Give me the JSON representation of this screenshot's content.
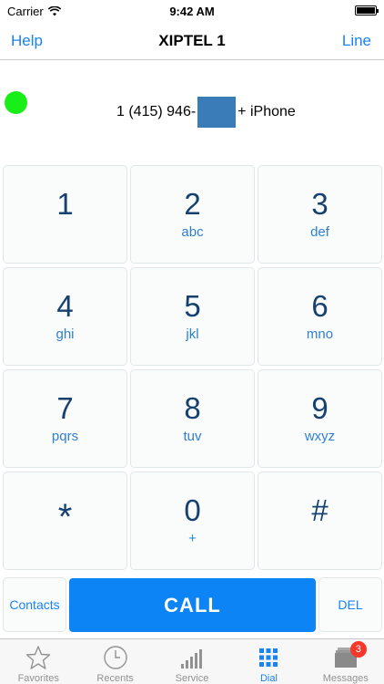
{
  "status_bar": {
    "carrier": "Carrier",
    "time": "9:42 AM"
  },
  "nav": {
    "left_label": "Help",
    "title": "XIPTEL 1",
    "right_label": "Line"
  },
  "line_info": {
    "status_color": "#18ee18",
    "number_prefix": "1 (415) 946-",
    "number_suffix": "+ iPhone"
  },
  "keypad": {
    "keys": [
      {
        "digit": "1",
        "letters": ""
      },
      {
        "digit": "2",
        "letters": "abc"
      },
      {
        "digit": "3",
        "letters": "def"
      },
      {
        "digit": "4",
        "letters": "ghi"
      },
      {
        "digit": "5",
        "letters": "jkl"
      },
      {
        "digit": "6",
        "letters": "mno"
      },
      {
        "digit": "7",
        "letters": "pqrs"
      },
      {
        "digit": "8",
        "letters": "tuv"
      },
      {
        "digit": "9",
        "letters": "wxyz"
      },
      {
        "digit": "*",
        "letters": ""
      },
      {
        "digit": "0",
        "letters": "+"
      },
      {
        "digit": "#",
        "letters": ""
      }
    ]
  },
  "actions": {
    "contacts_label": "Contacts",
    "call_label": "CALL",
    "del_label": "DEL"
  },
  "tab_bar": {
    "tabs": [
      {
        "label": "Favorites",
        "icon": "star-icon"
      },
      {
        "label": "Recents",
        "icon": "clock-icon"
      },
      {
        "label": "Service",
        "icon": "signal-bars-icon"
      },
      {
        "label": "Dial",
        "icon": "keypad-grid-icon"
      },
      {
        "label": "Messages",
        "icon": "messages-icon",
        "badge": "3"
      }
    ],
    "active_tab": "Dial"
  },
  "colors": {
    "accent": "#1a82f7",
    "call_button": "#0d84f5",
    "digit": "#16416f",
    "badge": "#f5382b"
  }
}
